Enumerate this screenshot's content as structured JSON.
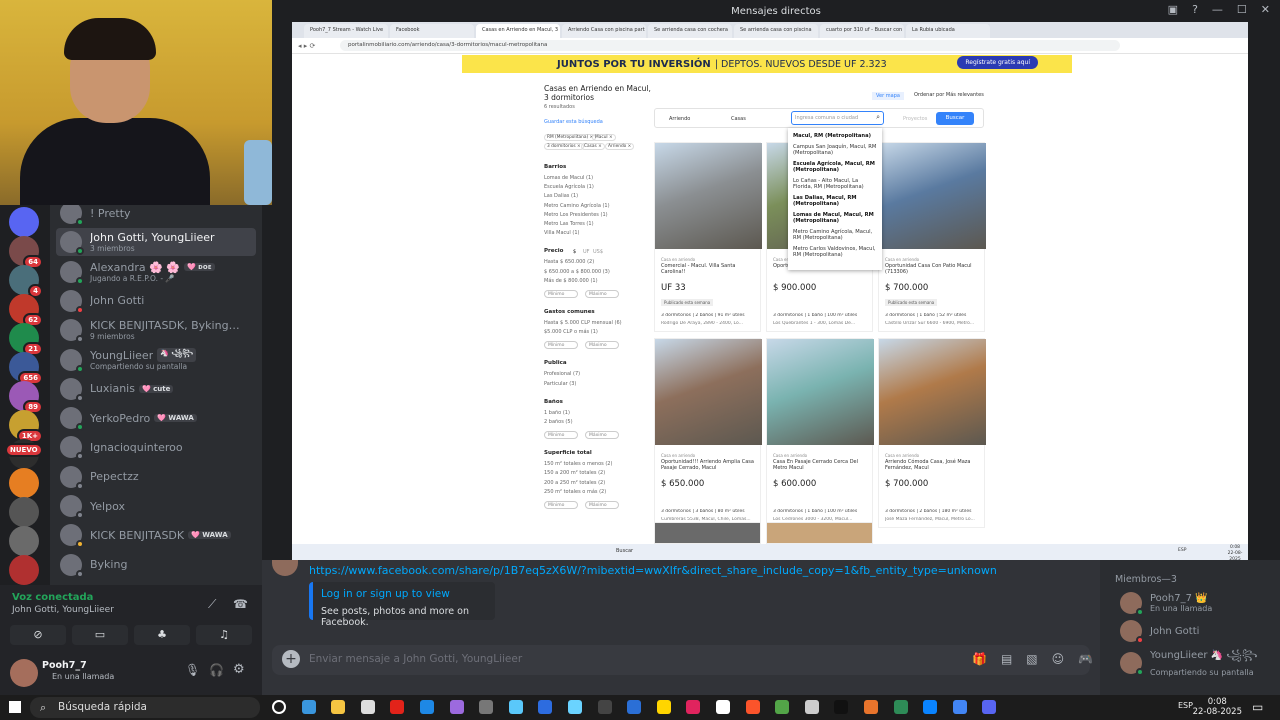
{
  "discord": {
    "window_title": "Mensajes directos",
    "dms": [
      {
        "name": "! Pretty",
        "sub": "",
        "tag": "",
        "selected": false
      },
      {
        "name": "John Gotti, YoungLiieer",
        "sub": "3 miembros",
        "tag": "",
        "selected": true
      },
      {
        "name": "Alexandra 🌸 🌸",
        "sub": "Jugando a R.E.P.O. - 🎤",
        "tag": "🩷 ᴅᴏᴇ",
        "selected": false
      },
      {
        "name": "John Gotti",
        "sub": "",
        "tag": "",
        "selected": false
      },
      {
        "name": "KICK BENJITASDK, Byking, Yelp...",
        "sub": "9 miembros",
        "tag": "",
        "selected": false
      },
      {
        "name": "YoungLiieer",
        "sub": "Compartiendo su pantalla",
        "tag": "🦄 ꧁꧂",
        "selected": false
      },
      {
        "name": "Luxianis",
        "sub": "",
        "tag": "🩷 cute",
        "selected": false
      },
      {
        "name": "YerkoPedro",
        "sub": "",
        "tag": "🩷 WAWA",
        "selected": false
      },
      {
        "name": "Ignacioquinteroo",
        "sub": "",
        "tag": "",
        "selected": false
      },
      {
        "name": "Pepectzz",
        "sub": "",
        "tag": "",
        "selected": false
      },
      {
        "name": "Yelpox",
        "sub": "",
        "tag": "",
        "selected": false
      },
      {
        "name": "KICK BENJITASDK",
        "sub": "",
        "tag": "🩷 WAWA",
        "selected": false
      },
      {
        "name": "Byking",
        "sub": "",
        "tag": "",
        "selected": false
      }
    ],
    "rail_badges": [
      "64",
      "4",
      "62",
      "21",
      "656",
      "89",
      "1K+",
      "NUEVO"
    ],
    "voice": {
      "status": "Voz conectada",
      "channel": "John Gotti, YoungLiieer"
    },
    "user": {
      "name": "Pooh7_7",
      "status": "En una llamada"
    },
    "chat": {
      "link": "https://www.facebook.com/share/p/1B7eq5zX6W/?mibextid=wwXIfr&direct_share_include_copy=1&fb_entity_type=unknown",
      "embed_title": "Log in or sign up to view",
      "embed_desc": "See posts, photos and more on Facebook.",
      "placeholder": "Enviar mensaje a John Gotti, YoungLiieer"
    },
    "members": {
      "header": "Miembros—3",
      "list": [
        {
          "name": "Pooh7_7 👑",
          "status": "En una llamada"
        },
        {
          "name": "John Gotti",
          "status": ""
        },
        {
          "name": "YoungLiieer 🦄 ꧁꧂",
          "status": "Compartiendo su pantalla"
        }
      ]
    }
  },
  "browser": {
    "tabs": [
      "Pooh7_7 Stream - Watch Live",
      "Facebook",
      "Casas en Arriendo en Macul, 3",
      "Arriendo Casa con piscina part",
      "Se arrienda casa con cochera",
      "Se arrienda casa con piscina",
      "cuarto por 310 uf - Buscar con",
      "La Rubia ubicada"
    ],
    "url": "portalinmobiliario.com/arriendo/casa/3-dormitorios/macul-metropolitana",
    "banner": {
      "title": "JUNTOS POR TU INVERSIÓN",
      "sub": "| DEPTOS. NUEVOS DESDE UF 2.323",
      "button": "Regístrate gratis aquí"
    },
    "page": {
      "title": "Casas en Arriendo en Macul, 3 dormitorios",
      "results": "6 resultados",
      "save_search": "Guardar esta búsqueda",
      "chips": [
        "RM (Metropolitana) ×",
        "Macul ×",
        "3 dormitorios ×",
        "Casas ×",
        "Arriendo ×"
      ],
      "filters": [
        {
          "head": "Barrios",
          "items": [
            "Lomas de Macul (1)",
            "Escuela Agrícola (1)",
            "Las Dalias (1)",
            "Metro Camino Agrícola (1)",
            "Metro Los Presidentes (1)",
            "Metro Las Torres (1)",
            "Villa Macul (1)"
          ]
        },
        {
          "head": "Precio",
          "items": [
            "Hasta $ 650.000 (2)",
            "$ 650.000 a $ 800.000 (3)",
            "Más de $ 800.000 (1)"
          ]
        },
        {
          "head": "Gastos comunes",
          "items": [
            "Hasta $ 5.000 CLP mensual (6)",
            "$5.000 CLP o más (1)"
          ]
        },
        {
          "head": "Publica",
          "items": [
            "Profesional (7)",
            "Particular (3)"
          ]
        },
        {
          "head": "Baños",
          "items": [
            "1 baño (1)",
            "2 baños (5)"
          ]
        },
        {
          "head": "Superficie total",
          "items": [
            "150 m² totales o menos (2)",
            "150 a 200 m² totales (2)",
            "200 a 250 m² totales (2)",
            "250 m² totales o más (2)"
          ]
        }
      ],
      "price_tabs": [
        "$",
        "UF",
        "US$"
      ],
      "min": "Mínimo",
      "max": "Máximo",
      "view_map": "Ver mapa",
      "sort": "Ordenar por  Más relevantes",
      "search": {
        "op": "Arriendo",
        "type": "Casas",
        "placeholder": "Ingresa comuna o ciudad",
        "proyectos": "Proyectos",
        "button": "Buscar"
      },
      "dropdown": [
        {
          "b": "Macul, RM (Metropolitana)",
          "p": ""
        },
        {
          "b": "",
          "p": "Campus San Joaquín, Macul, RM (Metropolitana)"
        },
        {
          "b": "Escuela Agrícola, Macul, RM (Metropolitana)",
          "p": ""
        },
        {
          "b": "",
          "p": "Lo Cañas - Alto Macul, La Florida, RM (Metropolitana)"
        },
        {
          "b": "Las Dalias, Macul, RM (Metropolitana)",
          "p": ""
        },
        {
          "b": "Lomas de Macul, Macul, RM (Metropolitana)",
          "p": ""
        },
        {
          "b": "",
          "p": "Metro Camino Agrícola, Macul, RM (Metropolitana)"
        },
        {
          "b": "",
          "p": "Metro Carlos Valdovinos, Macul, RM (Metropolitana)"
        }
      ],
      "cards": [
        {
          "ty": "Casa en arriendo",
          "title": "Comercial - Macul. Villa Santa Carolina!!",
          "price": "UF 33",
          "badge": "Publicado esta semana",
          "spec": "3 dormitorios | 2 baños | 91 m² útiles",
          "addr": "Rodrigo De Araya, 2890 - 2400, Lo...",
          "color": "#8b8f92"
        },
        {
          "ty": "Casa en arriendo",
          "title": "Oportunidad Arriendo Casa Macul",
          "price": "$ 900.000",
          "badge": "",
          "spec": "3 dormitorios | 1 baño | 100 m² útiles",
          "addr": "Los Quebrantes 1 - 300, Lomas De...",
          "color": "#7b8f5a"
        },
        {
          "ty": "Casa en arriendo",
          "title": "Oportunidad Casa Con Patio Macul (713306)",
          "price": "$ 700.000",
          "badge": "Publicado esta semana",
          "spec": "3 dormitorios | 1 baño | 52 m² útiles",
          "addr": "Castillo Urízar Sur 6600 - 6900, Metro...",
          "color": "#5a7aa0"
        },
        {
          "ty": "Casa en arriendo",
          "title": "Oportunidad!!! Arriendo Amplia Casa Pasaje Cerrado, Macul",
          "price": "$ 650.000",
          "badge": "",
          "spec": "3 dormitorios | 3 baños | 80 m² útiles",
          "addr": "Cumbreras 5538, Macul, Chile, Lomas...",
          "color": "#8d6f5c"
        },
        {
          "ty": "Casa en arriendo",
          "title": "Casa En Pasaje Cerrado Cerca Del Metro Macul",
          "price": "$ 600.000",
          "badge": "",
          "spec": "3 dormitorios | 1 baño | 100 m² útiles",
          "addr": "Los Cedrones 3000 - 3200, Macul...",
          "color": "#7ab3b0"
        },
        {
          "ty": "Casa en arriendo",
          "title": "Arriendo Cómoda Casa, José Maza Fernández, Macul",
          "price": "$ 700.000",
          "badge": "",
          "spec": "3 dormitorios | 2 baños | 180 m² útiles",
          "addr": "José Maza Fernández, Macul, Metro Lo...",
          "color": "#b07a4a"
        }
      ]
    },
    "taskbar": {
      "search": "Buscar",
      "lang": "ESP",
      "time": "0:08",
      "date": "22-08-2025"
    }
  },
  "taskbar": {
    "search": "Búsqueda rápida",
    "lang": "ESP",
    "time": "0:08",
    "date": "22-08-2025"
  }
}
